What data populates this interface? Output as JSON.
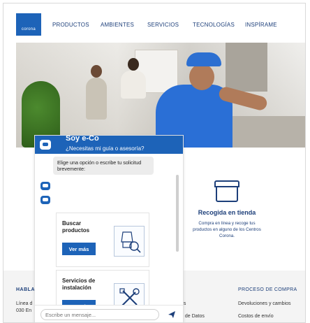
{
  "header": {
    "logo_text": "corona",
    "nav": [
      "PRODUCTOS",
      "AMBIENTES",
      "SERVICIOS",
      "TECNOLOGÍAS",
      "INSPÍRAME"
    ]
  },
  "store_pickup": {
    "title": "Recogida en tienda",
    "description": "Compra en línea y recoge tus productos en alguno de los Centros Corona."
  },
  "footer": {
    "hablemos": "HABLA",
    "line1": "Línea d",
    "line2": "030 En",
    "mid1": "es",
    "mid2": "o de Datos",
    "proceso_title": "PROCESO DE COMPRA",
    "devoluciones": "Devoluciones y cambios",
    "costos": "Costos de envío"
  },
  "chat": {
    "title": "Soy e-Co",
    "subtitle": "¿Necesitas mi guía o asesoría?",
    "prompt": "Elige una opción o escribe tu solicitud brevemente:",
    "cards": [
      {
        "title": "Buscar productos",
        "button": "Ver más",
        "icon": "product-search-icon"
      },
      {
        "title": "Servicios de instalación",
        "button": "Ver más",
        "icon": "tools-icon"
      }
    ],
    "input_placeholder": "Escribe un mensaje..."
  },
  "colors": {
    "brand_blue": "#1d63b8",
    "nav_text": "#1d3f7a"
  }
}
